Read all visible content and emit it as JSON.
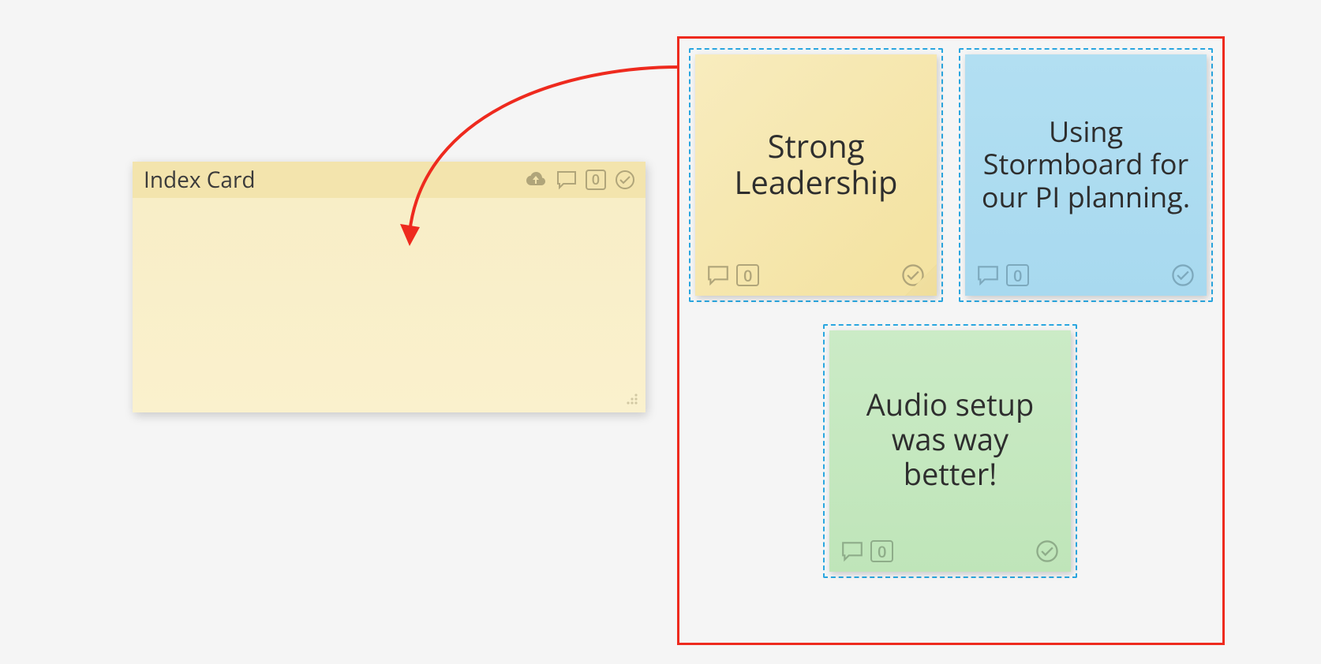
{
  "index_card": {
    "title": "Index Card",
    "icons": {
      "upload": "upload-icon",
      "comment": "comment-icon",
      "count": "0",
      "check": "check-icon"
    }
  },
  "stickies": [
    {
      "id": "yellow",
      "text": "Strong Leadership",
      "count": "0"
    },
    {
      "id": "blue",
      "text": "Using Stormboard for our PI planning.",
      "count": "0"
    },
    {
      "id": "green",
      "text": "Audio setup was way better!",
      "count": "0"
    }
  ]
}
